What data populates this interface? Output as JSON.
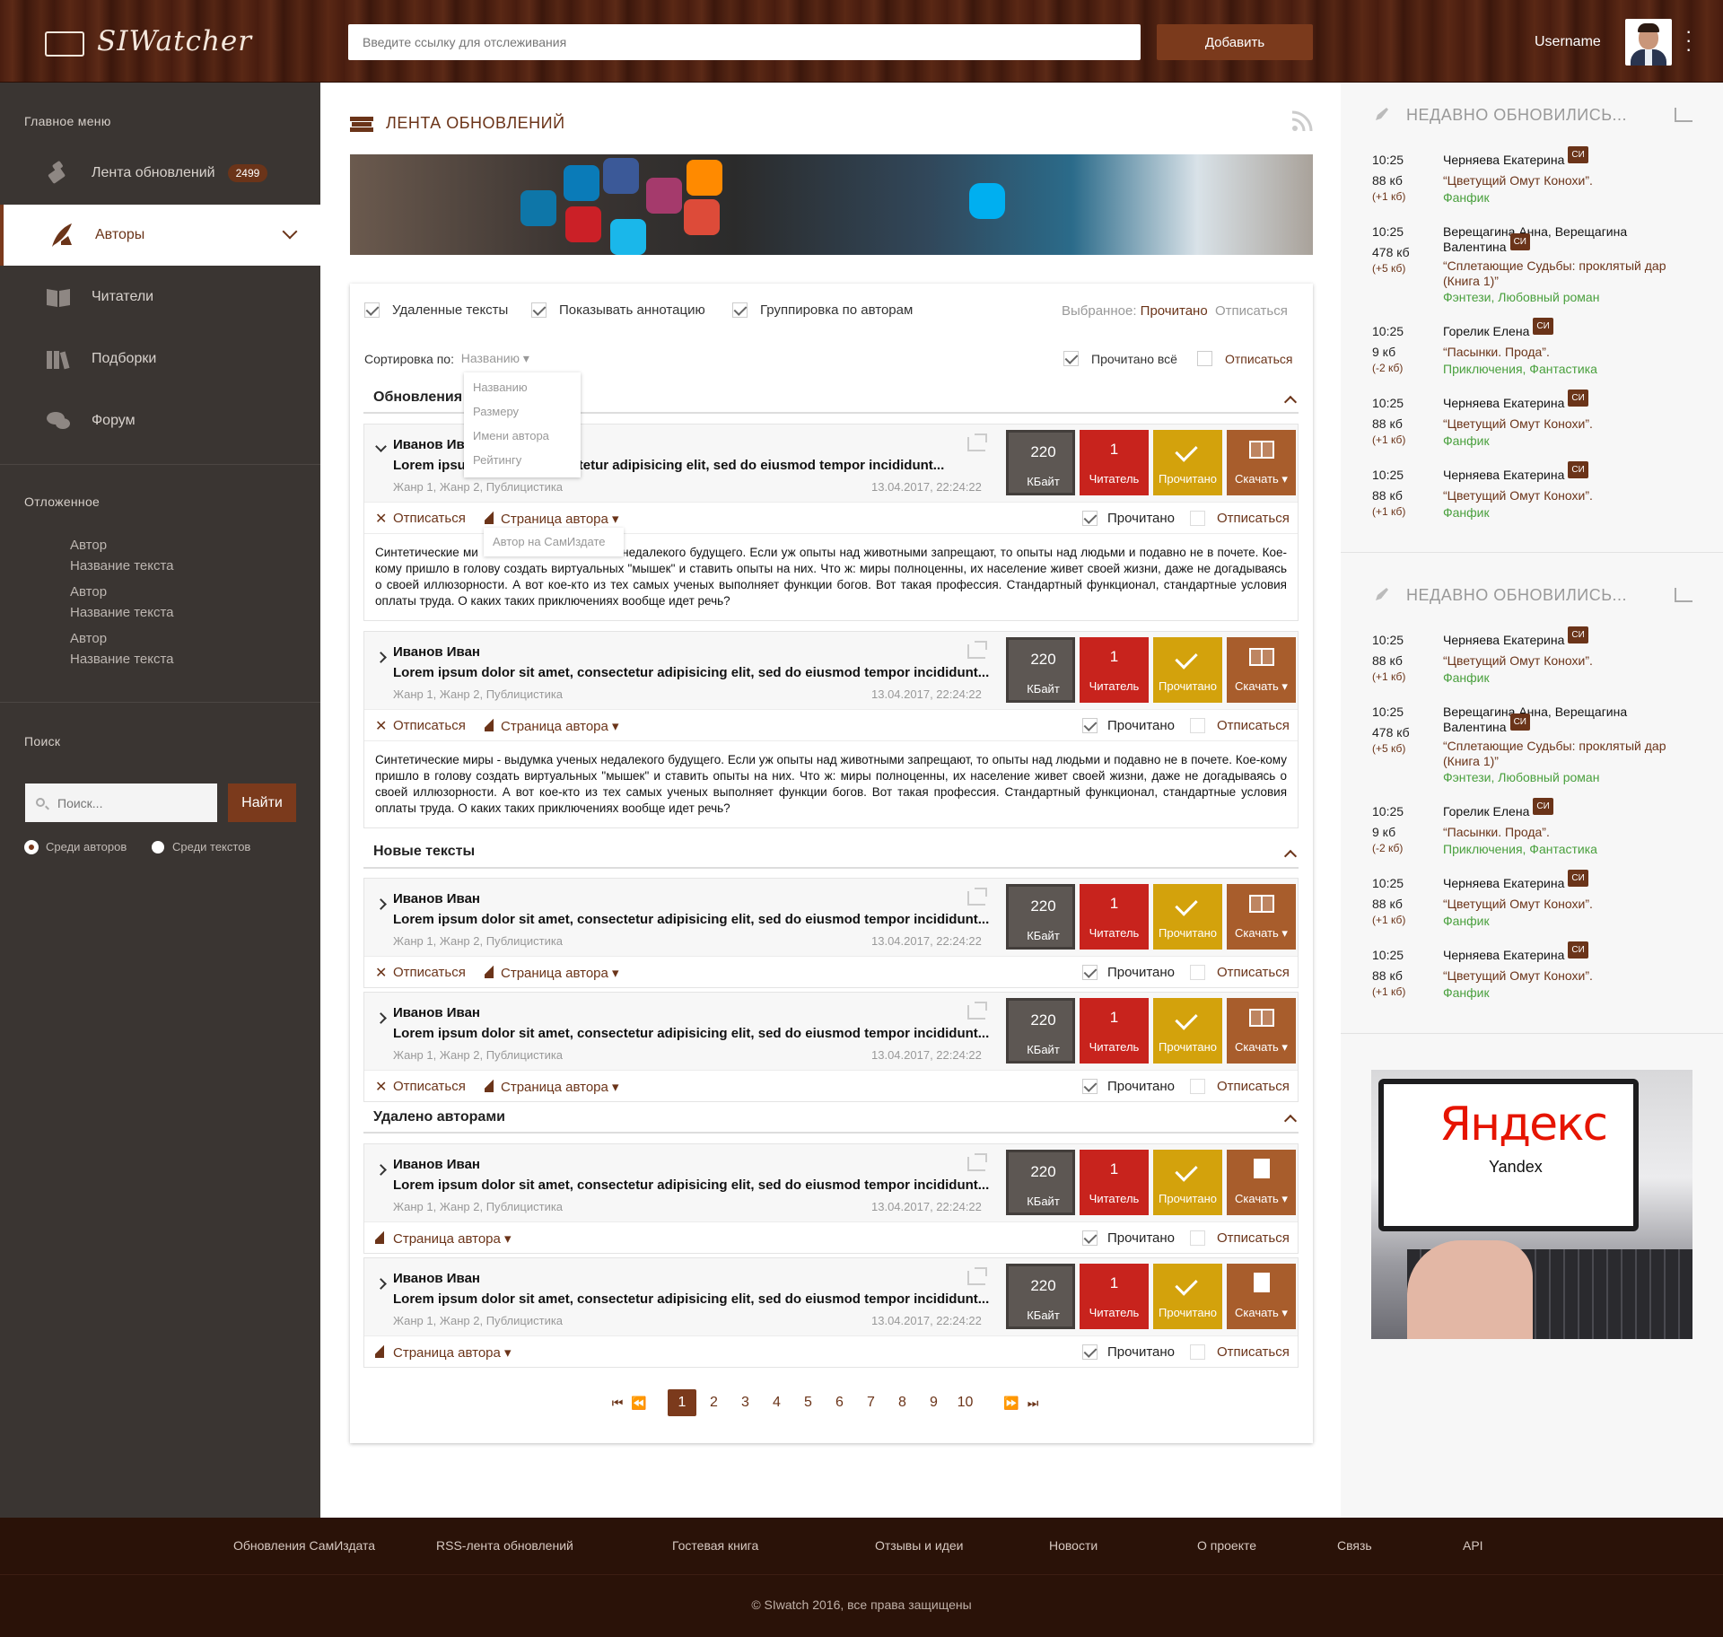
{
  "header": {
    "app_title": "SIWatcher",
    "url_placeholder": "Введите ссылку для отслеживания",
    "add_label": "Добавить",
    "username": "Username"
  },
  "sidebar": {
    "main_menu_heading": "Главное меню",
    "items": [
      {
        "label": "Лента обновлений",
        "badge": "2499"
      },
      {
        "label": "Авторы"
      },
      {
        "label": "Читатели"
      },
      {
        "label": "Подборки"
      },
      {
        "label": "Форум"
      }
    ],
    "later_heading": "Отложенное",
    "later": [
      {
        "author": "Автор",
        "title": "Название текста"
      },
      {
        "author": "Автор",
        "title": "Название текста"
      },
      {
        "author": "Автор",
        "title": "Название текста"
      }
    ],
    "search_heading": "Поиск",
    "search_placeholder": "Поиск...",
    "find_label": "Найти",
    "radio_authors": "Среди авторов",
    "radio_texts": "Среди текстов"
  },
  "feed": {
    "title": "ЛЕНТА ОБНОВЛЕНИЙ",
    "opt_deleted": "Удаленные тексты",
    "opt_annotation": "Показывать аннотацию",
    "opt_group": "Группировка по авторам",
    "selected_label": "Выбранное:",
    "selected_read": "Прочитано",
    "selected_unsub": "Отписаться",
    "sort_label": "Сортировка по:",
    "sort_value": "Названию ▾",
    "read_all": "Прочитано всё",
    "unsub": "Отписаться",
    "sort_options": [
      "Названию",
      "Размеру",
      "Имени автора",
      "Рейтингу"
    ],
    "tooltip": "Автор на СамИздате",
    "sections": [
      "Обновления",
      "Новые тексты",
      "Удалено авторами"
    ],
    "card": {
      "author": "Иванов Иван",
      "lorem": "Lorem ipsum dolor sit amet, consectetur adipisicing elit, sed do eiusmod tempor incididunt...",
      "genre": "Жанр 1, Жанр 2, Публицистика",
      "date": "13.04.2017, 22:24:22",
      "size": "220",
      "size_unit": "КБайт",
      "readers": "1",
      "readers_label": "Читатель",
      "read_label": "Прочитано",
      "download_label": "Скачать ▾",
      "unsubscribe": "Отписаться",
      "author_page": "Страница автора ▾",
      "read": "Прочитано",
      "unsub": "Отписаться"
    },
    "annotation": "Синтетические миры - выдумка ученых недалекого будущего. Если уж опыты над животными запрещают, то опыты над людьми и подавно не в почете. Кое-кому пришло в голову создать виртуальных \"мышек\" и ставить опыты на них. Что ж: миры полноценны, их население живет своей жизни, даже не догадываясь о своей иллюзорности. А вот кое-кто из тех самых ученых выполняет функции богов. Вот такая профессия. Стандартный функционал, стандартные условия оплаты труда. О каких таких приключениях вообще идет речь?",
    "annotation_short_prefix": "Синтетические ми",
    "annotation_rest": "недалекого будущего. Если уж опыты над животными запрещают, то опыты над людьми и подавно не в почете. Кое-кому пришло в голову создать виртуальных \"мышек\" и ставить опыты на них. Что ж: миры полноценны, их население живет своей жизни, даже не догадываясь о своей иллюзорности. А вот кое-кто из тех самых ученых выполняет функции богов. Вот такая профессия. Стандартный функционал, стандартные условия оплаты труда. О каких таких приключениях вообще идет речь?",
    "author_trunc": "Иванов Ив",
    "lorem_trunc": "nsectetur adipisicing elit, sed do eiusmod tempor incididunt...",
    "lorem_start": "Lorem ipsu",
    "genre_start": "Жанр 1, Жанр 2, Публицистика",
    "pages": [
      "1",
      "2",
      "3",
      "4",
      "5",
      "6",
      "7",
      "8",
      "9",
      "10"
    ]
  },
  "recent": {
    "title": "НЕДАВНО ОБНОВИЛИСЬ...",
    "si": "СИ",
    "items": [
      {
        "time": "10:25",
        "size": "88 кб",
        "delta": "(+1 кб)",
        "name": "Черняева Екатерина",
        "work": "“Цветущий Омут Конохи”.",
        "genre": "Фанфик"
      },
      {
        "time": "10:25",
        "size": "478 кб",
        "delta": "(+5 кб)",
        "name": "Верещагина Анна, Верещагина Валентина",
        "work": "“Сплетающие Судьбы: проклятый дар (Книга 1)”",
        "genre": "Фэнтези, Любовный роман"
      },
      {
        "time": "10:25",
        "size": "9 кб",
        "delta": "(-2 кб)",
        "name": "Горелик Елена",
        "work": "“Пасынки. Прода”.",
        "genre": "Приключения, Фантастика"
      },
      {
        "time": "10:25",
        "size": "88 кб",
        "delta": "(+1 кб)",
        "name": "Черняева Екатерина",
        "work": "“Цветущий Омут Конохи”.",
        "genre": "Фанфик"
      },
      {
        "time": "10:25",
        "size": "88 кб",
        "delta": "(+1 кб)",
        "name": "Черняева Екатерина",
        "work": "“Цветущий Омут Конохи”.",
        "genre": "Фанфик"
      }
    ],
    "ad_logo_red": "Я",
    "ad_logo_rest": "ндекс",
    "ad_sub": "Yandex"
  },
  "footer": {
    "links": [
      "Обновления СамИздата",
      "RSS-лента обновлений",
      "Гостевая книга",
      "Отзывы и идеи",
      "Новости",
      "О проекте",
      "Связь",
      "API"
    ],
    "copyright": "© SIwatch 2016, все права защищены"
  }
}
